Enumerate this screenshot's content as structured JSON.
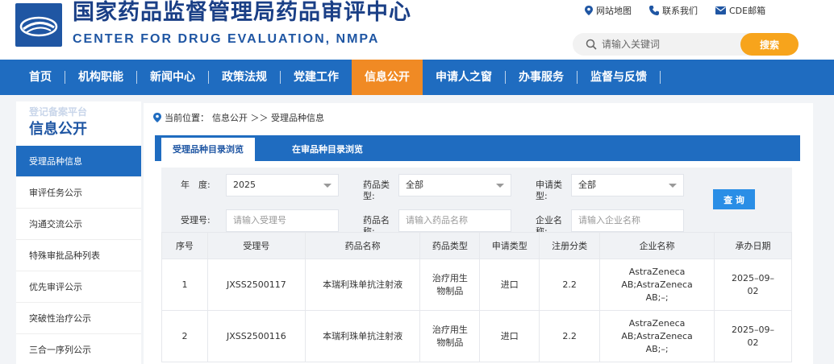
{
  "header": {
    "title_cn": "国家药品监督管理局药品审评中心",
    "title_en": "CENTER FOR DRUG EVALUATION, NMPA",
    "links": [
      {
        "label": "网站地图",
        "icon": "location-pin-icon"
      },
      {
        "label": "联系我们",
        "icon": "phone-icon"
      },
      {
        "label": "CDE邮箱",
        "icon": "mail-icon"
      }
    ],
    "search_placeholder": "请输入关键词",
    "search_button": "搜索"
  },
  "nav": {
    "items": [
      "首页",
      "机构职能",
      "新闻中心",
      "政策法规",
      "党建工作",
      "信息公开",
      "申请人之窗",
      "办事服务",
      "监督与反馈"
    ],
    "active_index": 5
  },
  "sidebar": {
    "ghost_text": "登记备案平台",
    "title": "信息公开",
    "items": [
      "受理品种信息",
      "审评任务公示",
      "沟通交流公示",
      "特殊审批品种列表",
      "优先审评公示",
      "突破性治疗公示",
      "三合一序列公示"
    ]
  },
  "breadcrumb": {
    "prefix": "当前位置：",
    "path": "信息公开 ＞＞ 受理品种信息"
  },
  "tabs": [
    "受理品种目录浏览",
    "在审品种目录浏览"
  ],
  "filter": {
    "year_label": "年　度:",
    "year_value": "2025",
    "drug_type_label": "药品类型:",
    "drug_type_value": "全部",
    "apply_type_label": "申请类型:",
    "apply_type_value": "全部",
    "accept_no_label": "受理号:",
    "accept_no_placeholder": "请输入受理号",
    "drug_name_label": "药品名称:",
    "drug_name_placeholder": "请输入药品名称",
    "company_label": "企业名称:",
    "company_placeholder": "请输入企业名称",
    "query_button": "查 询"
  },
  "table": {
    "columns": [
      "序号",
      "受理号",
      "药品名称",
      "药品类型",
      "申请类型",
      "注册分类",
      "企业名称",
      "承办日期"
    ],
    "rows": [
      [
        "1",
        "JXSS2500117",
        "本瑞利珠单抗注射液",
        "治疗用生物制品",
        "进口",
        "2.2",
        "AstraZeneca AB;AstraZeneca AB;–;",
        "2025–09–02"
      ],
      [
        "2",
        "JXSS2500116",
        "本瑞利珠单抗注射液",
        "治疗用生物制品",
        "进口",
        "2.2",
        "AstraZeneca AB;AstraZeneca AB;–;",
        "2025–09–02"
      ]
    ]
  },
  "colors": {
    "nav_blue": "#1f6cc0",
    "active_orange": "#f08a24",
    "search_orange": "#f7a41c",
    "title_blue": "#1a3f86"
  }
}
